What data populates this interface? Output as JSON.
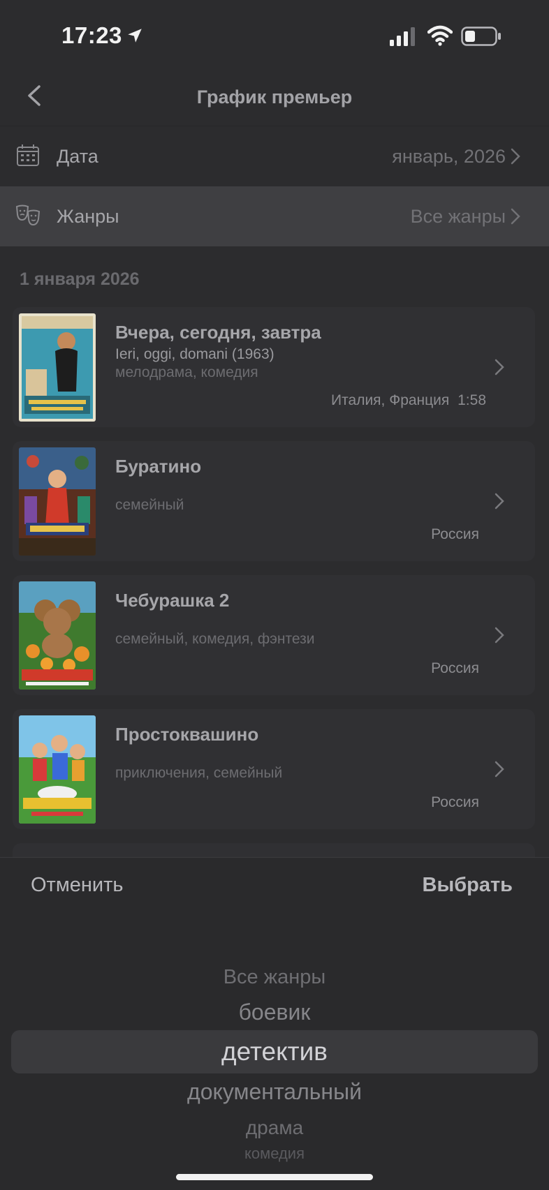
{
  "status_bar": {
    "time": "17:23"
  },
  "nav": {
    "title": "График премьер"
  },
  "filters": {
    "date": {
      "label": "Дата",
      "value": "январь, 2026"
    },
    "genre": {
      "label": "Жанры",
      "value": "Все жанры"
    }
  },
  "section_date": "1 января 2026",
  "movies": [
    {
      "title": "Вчера, сегодня, завтра",
      "original": "Ieri, oggi, domani (1963)",
      "genres": "мелодрама, комедия",
      "country": "Италия, Франция",
      "duration": "1:58"
    },
    {
      "title": "Буратино",
      "original": "",
      "genres": "семейный",
      "country": "Россия",
      "duration": ""
    },
    {
      "title": "Чебурашка 2",
      "original": "",
      "genres": "семейный, комедия, фэнтези",
      "country": "Россия",
      "duration": ""
    },
    {
      "title": "Простоквашино",
      "original": "",
      "genres": "приключения, семейный",
      "country": "Россия",
      "duration": ""
    }
  ],
  "picker": {
    "cancel_label": "Отменить",
    "select_label": "Выбрать",
    "options": [
      "Все жанры",
      "боевик",
      "детектив",
      "документальный",
      "драма",
      "комедия"
    ],
    "selected": "детектив"
  },
  "colors": {
    "background": "#2c2c2e",
    "highlight_row": "#3f3f42",
    "card": "#303033"
  }
}
